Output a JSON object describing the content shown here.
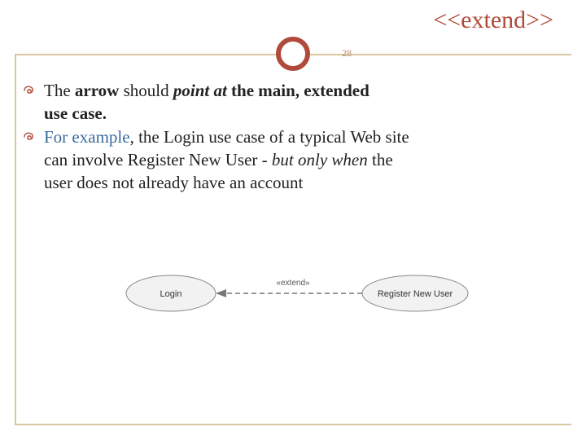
{
  "title": "<<extend>>",
  "page_number": "28",
  "bullets": [
    {
      "segments": [
        {
          "text": "The ",
          "style": "plain"
        },
        {
          "text": "arrow",
          "style": "bold"
        },
        {
          "text": " should ",
          "style": "plain"
        },
        {
          "text": "point at",
          "style": "bold-italic"
        },
        {
          "text": " the main, extended use case.",
          "style": "bold"
        }
      ]
    },
    {
      "segments": [
        {
          "text": "For example",
          "style": "blue"
        },
        {
          "text": ", the Login use case of a typical Web site can involve Register New User - ",
          "style": "plain"
        },
        {
          "text": "but only when",
          "style": "italic"
        },
        {
          "text": " the user does not already have an account",
          "style": "plain"
        }
      ]
    }
  ],
  "diagram": {
    "left_usecase": "Login",
    "right_usecase": "Register New User",
    "relation_label": "«extend»"
  },
  "b1_s0": "The ",
  "b1_s1": "arrow",
  "b1_s2": " should ",
  "b1_s3": "point at",
  "b1_s4": " the main, extended",
  "b1_cont": "use case.",
  "b2_s0": "For example",
  "b2_s1": ", the Login use case of a typical Web site",
  "b2_c1": "can involve Register New User - ",
  "b2_c1i": "but only when",
  "b2_c1b": " the",
  "b2_c2": "user does not already have an account"
}
